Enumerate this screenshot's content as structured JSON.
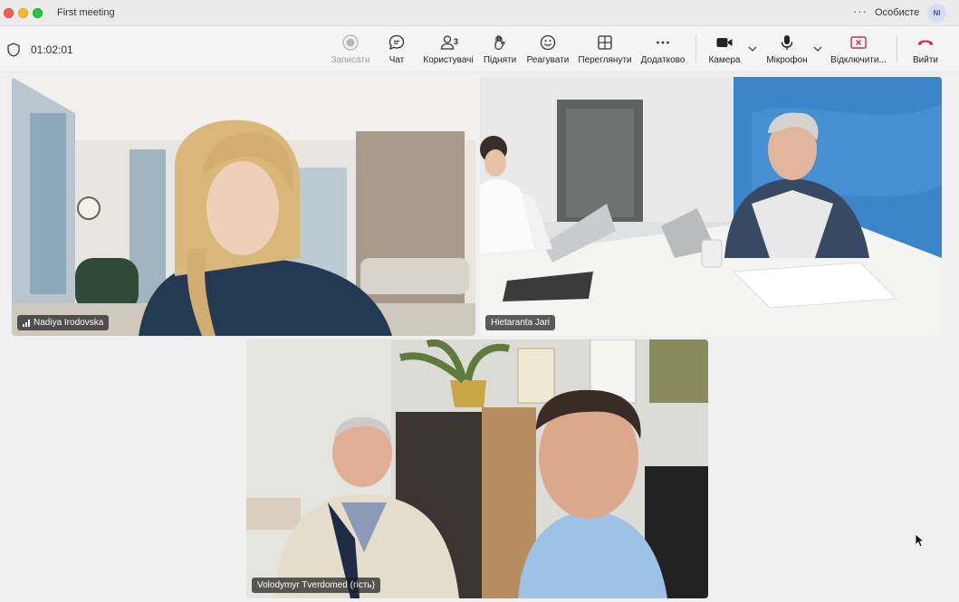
{
  "window": {
    "title": "First meeting",
    "more_label": "···",
    "profile_label": "Особисте",
    "avatar_initials": "NI"
  },
  "toolbar": {
    "timer": "01:02:01",
    "record_label": "Записати",
    "chat_label": "Чат",
    "people_label": "Користувачі",
    "people_count": "3",
    "raise_label": "Підняти",
    "react_label": "Реагувати",
    "view_label": "Переглянути",
    "more_label": "Додатково",
    "camera_label": "Камера",
    "mic_label": "Мікрофон",
    "share_label": "Відключити...",
    "leave_label": "Вийти"
  },
  "participants": [
    {
      "name": "Nadiya Irodovska",
      "speaking": false,
      "show_signal": true
    },
    {
      "name": "Hietaranta Jari",
      "speaking": true,
      "show_signal": false
    },
    {
      "name": "Volodymyr Tverdomed (гість)",
      "speaking": true,
      "show_signal": false
    }
  ],
  "colors": {
    "accent": "#7b83eb",
    "leave": "#c4314b",
    "share": "#c4314b"
  }
}
